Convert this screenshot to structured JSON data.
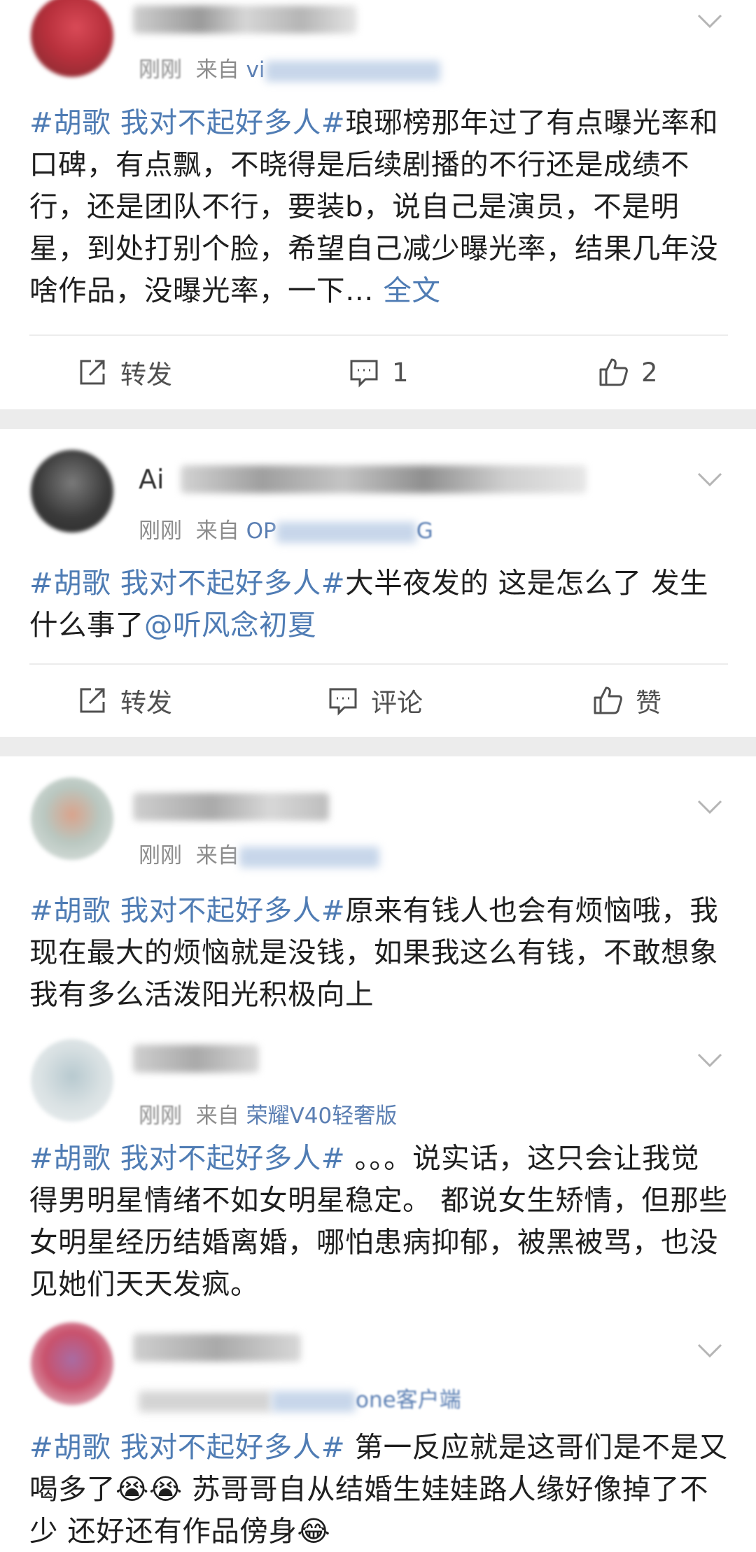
{
  "posts": [
    {
      "meta_prefix": "刚刚",
      "meta_from": "来自",
      "source": "vi",
      "hashtag": "#胡歌 我对不起好多人#",
      "text": "琅琊榜那年过了有点曝光率和口碑，有点飘，不晓得是后续剧播的不行还是成绩不行，还是团队不行，要装b，说自己是演员，不是明星，到处打别个脸，希望自己减少曝光率，结果几年没啥作品，没曝光率，一下…",
      "more": "全文",
      "actions": {
        "repost": "转发",
        "comment": "1",
        "like": "2"
      }
    },
    {
      "name_prefix": "Ai",
      "meta_prefix": "刚刚",
      "meta_from": "来自",
      "source": "OP",
      "source_tail": "G",
      "hashtag": "#胡歌 我对不起好多人#",
      "text": "大半夜发的 这是怎么了 发生什么事了",
      "mention": "@听风念初夏",
      "actions": {
        "repost": "转发",
        "comment": "评论",
        "like": "赞"
      }
    },
    {
      "meta_prefix": "刚刚",
      "meta_from": "来自",
      "hashtag": "#胡歌 我对不起好多人#",
      "text": "原来有钱人也会有烦恼哦，我现在最大的烦恼就是没钱，如果我这么有钱，不敢想象我有多么活泼阳光积极向上"
    },
    {
      "meta_prefix": "刚刚",
      "meta_from": "来自",
      "source": "荣耀V40轻奢版",
      "hashtag": "#胡歌 我对不起好多人#",
      "text": " 。。。说实话，这只会让我觉得男明星情绪不如女明星稳定。 都说女生矫情，但那些女明星经历结婚离婚，哪怕患病抑郁，被黑被骂，也没见她们天天发疯。"
    },
    {
      "source_tail": "one客户端",
      "hashtag": "#胡歌 我对不起好多人#",
      "text": " 第一反应就是这哥们是不是又喝多了😭😭 苏哥哥自从结婚生娃娃路人缘好像掉了不少 还好还有作品傍身😂"
    }
  ],
  "colors": {
    "link": "#4f7cb4",
    "text": "#1f1f1f",
    "meta": "#8c8c8c",
    "divider": "#ececec"
  },
  "icons": [
    "chevron-down-icon",
    "repost-icon",
    "comment-icon",
    "like-icon"
  ]
}
